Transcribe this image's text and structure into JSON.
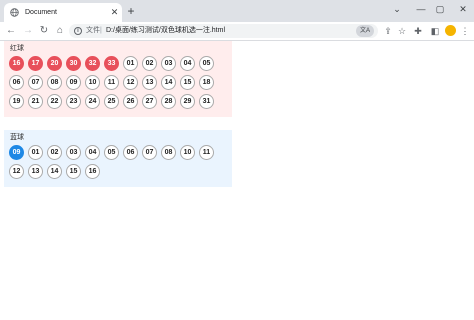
{
  "tab": {
    "title": "Document",
    "close": "✕"
  },
  "newtab": "+",
  "window": {
    "tab_search": "⌄",
    "minimize": "—",
    "maximize": "▢",
    "close": "✕"
  },
  "toolbar": {
    "back": "←",
    "forward": "→",
    "reload": "↻",
    "home": "⌂",
    "info": "i",
    "file_label": "文件",
    "separator": "|",
    "url": "D:/桌面/练习测试/双色球机选一注.html",
    "translate": "文A",
    "share": "⇪",
    "star": "☆",
    "extensions": "✚",
    "sidebar": "◧",
    "menu": "⋮"
  },
  "red": {
    "label": "红球",
    "balls": [
      "16",
      "17",
      "20",
      "30",
      "32",
      "33",
      "01",
      "02",
      "03",
      "04",
      "05",
      "06",
      "07",
      "08",
      "09",
      "10",
      "11",
      "12",
      "13",
      "14",
      "15",
      "18",
      "19",
      "21",
      "22",
      "23",
      "24",
      "25",
      "26",
      "27",
      "28",
      "29",
      "31"
    ],
    "selected_count": 6
  },
  "blue": {
    "label": "蓝球",
    "balls": [
      "09",
      "01",
      "02",
      "03",
      "04",
      "05",
      "06",
      "07",
      "08",
      "10",
      "11",
      "12",
      "13",
      "14",
      "15",
      "16"
    ],
    "selected_count": 1
  },
  "colors": {
    "red_selected": "#e8505b",
    "blue_selected": "#1e88e5",
    "red_panel": "#ffeded",
    "blue_panel": "#eaf4fe"
  }
}
